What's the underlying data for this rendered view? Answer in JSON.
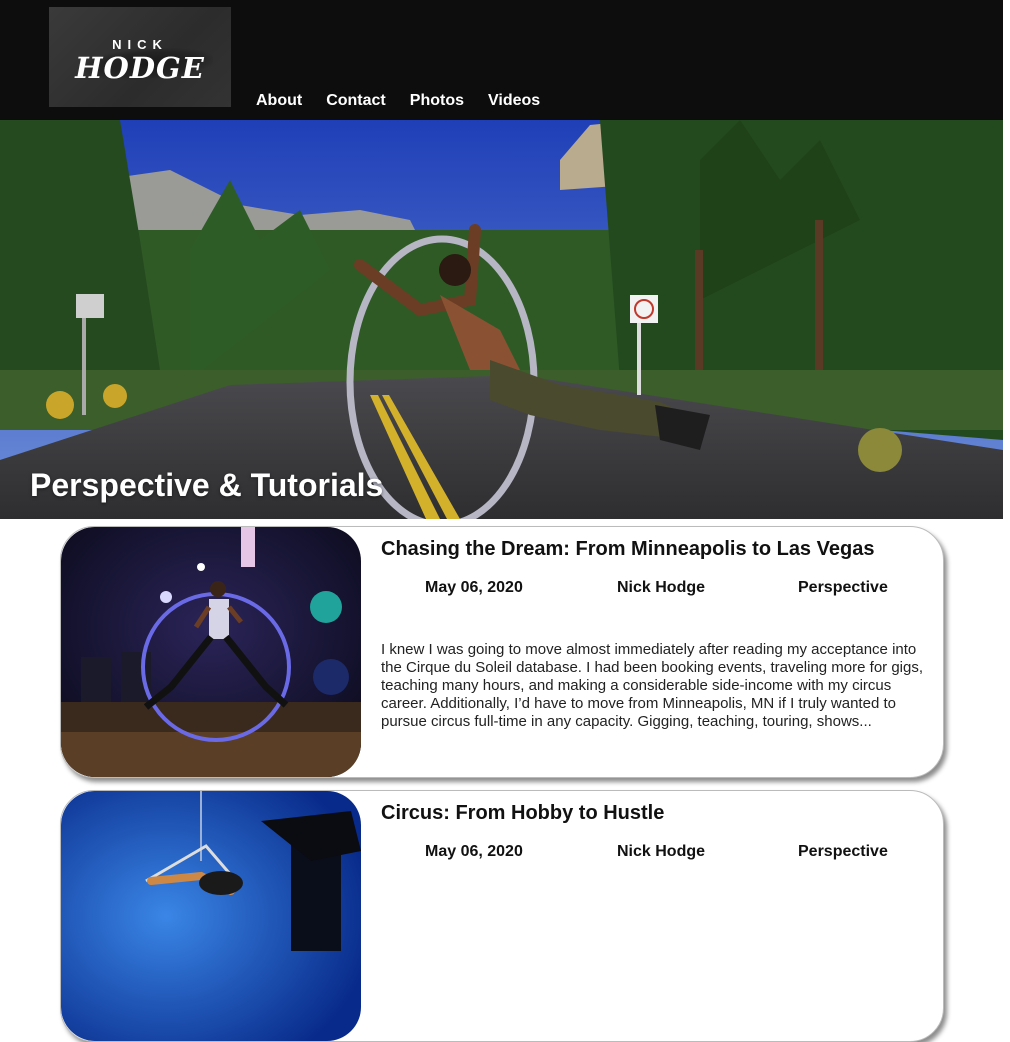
{
  "logo": {
    "line1": "NICK",
    "line2": "HODGE"
  },
  "nav": {
    "items": [
      {
        "label": "About"
      },
      {
        "label": "Contact"
      },
      {
        "label": "Photos"
      },
      {
        "label": "Videos"
      }
    ]
  },
  "hero": {
    "title": "Perspective & Tutorials"
  },
  "posts": [
    {
      "title": "Chasing the Dream: From Minneapolis to Las Vegas",
      "date": "May 06, 2020",
      "author": "Nick Hodge",
      "category": "Perspective",
      "excerpt": "I knew I was going to move almost immediately after reading my acceptance into the Cirque du Soleil database. I had been booking events, traveling more for gigs, teaching many hours, and making a considerable side-income with my circus career. Additionally, I’d have to move from Minneapolis, MN if I truly wanted to pursue circus full-time in any capacity. Gigging, teaching, touring, shows..."
    },
    {
      "title": "Circus: From Hobby to Hustle",
      "date": "May 06, 2020",
      "author": "Nick Hodge",
      "category": "Perspective",
      "excerpt": ""
    }
  ]
}
